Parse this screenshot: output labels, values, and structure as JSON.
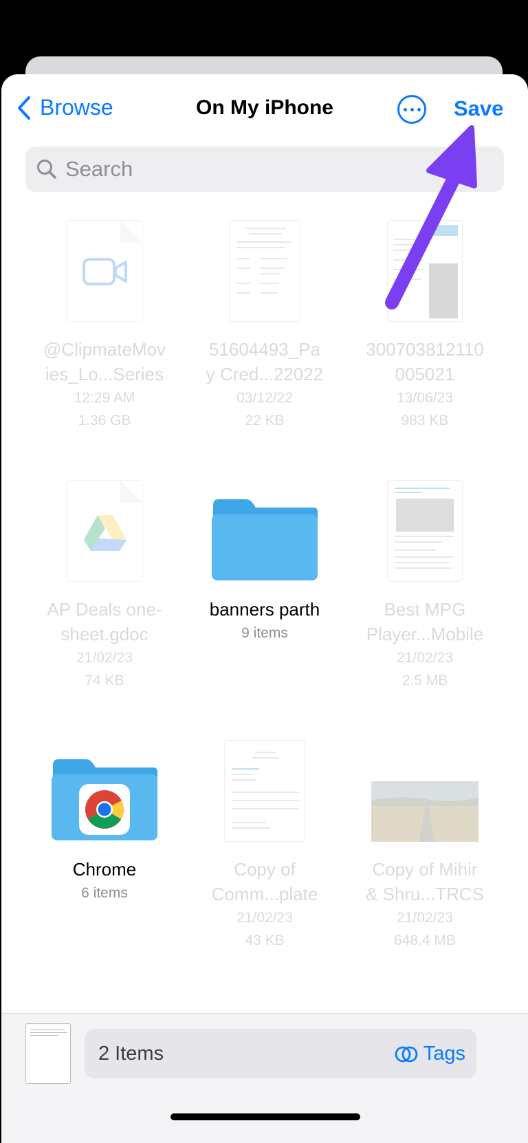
{
  "nav": {
    "back_label": "Browse",
    "title": "On My iPhone",
    "save_label": "Save"
  },
  "search": {
    "placeholder": "Search"
  },
  "files": [
    {
      "name": "@ClipmateMovies_Lo...Series",
      "line1": "@ClipmateMov",
      "line2": "ies_Lo...Series",
      "date": "12:29 AM",
      "size": "1.36 GB"
    },
    {
      "name": "51604493_Pay Cred...22022",
      "line1": "51604493_Pa",
      "line2": "y Cred...22022",
      "date": "03/12/22",
      "size": "22 KB"
    },
    {
      "name": "300703812110005021",
      "line1": "300703812110",
      "line2": "005021",
      "date": "13/06/23",
      "size": "983 KB"
    },
    {
      "name": "AP Deals one-sheet.gdoc",
      "line1": "AP Deals one-",
      "line2": "sheet.gdoc",
      "date": "21/02/23",
      "size": "74 KB"
    },
    {
      "name": "banners parth",
      "line1": "banners parth",
      "line2": "",
      "date": "9 items",
      "size": ""
    },
    {
      "name": "Best MPG Player...Mobile",
      "line1": "Best MPG",
      "line2": "Player...Mobile",
      "date": "21/02/23",
      "size": "2.5 MB"
    },
    {
      "name": "Chrome",
      "line1": "Chrome",
      "line2": "",
      "date": "6 items",
      "size": ""
    },
    {
      "name": "Copy of Comm...plate",
      "line1": "Copy of",
      "line2": "Comm...plate",
      "date": "21/02/23",
      "size": "43 KB"
    },
    {
      "name": "Copy of Mihir & Shru...TRCS",
      "line1": "Copy of Mihir",
      "line2": "& Shru...TRCS",
      "date": "21/02/23",
      "size": "648.4 MB"
    }
  ],
  "bottom": {
    "items_count": "2 Items",
    "tags_label": "Tags"
  },
  "colors": {
    "accent": "#0a7aff",
    "annotation_arrow": "#7b3ff2",
    "folder": "#5ab8f0"
  }
}
